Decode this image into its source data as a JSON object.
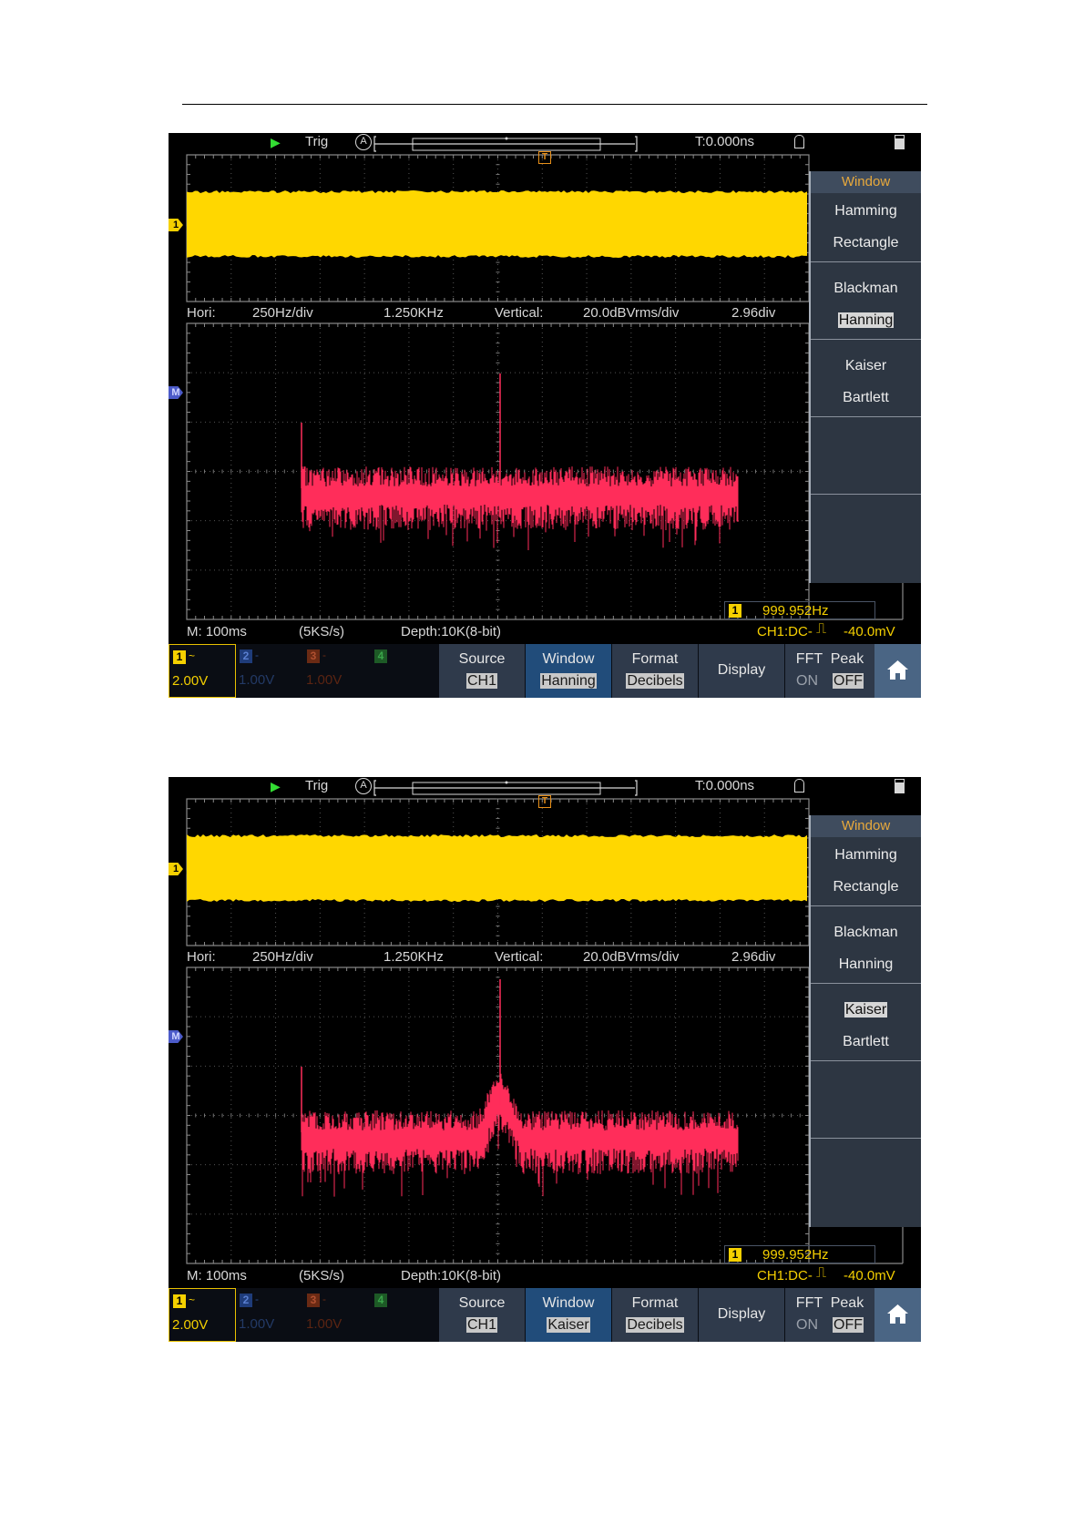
{
  "screens": [
    {
      "top": {
        "trig": "Trig",
        "auto": "A",
        "time": "T:0.000ns"
      },
      "fft_info": {
        "hori_label": "Hori:",
        "hori_scale": "250Hz/div",
        "hori_center": "1.250KHz",
        "vert_label": "Vertical:",
        "vert_scale": "20.0dBVrms/div",
        "vert_pos": "2.96div"
      },
      "markers": {
        "ch1": "1",
        "math": "M",
        "trigger": "T"
      },
      "window_menu": {
        "title": "Window",
        "options": [
          "Hamming",
          "Rectangle",
          "Blackman",
          "Hanning",
          "Kaiser",
          "Bartlett"
        ],
        "selected": "Hanning"
      },
      "freq_counter": {
        "channel": "1",
        "value": "999.952Hz"
      },
      "status": {
        "timebase": "M: 100ms",
        "sample_rate": "(5KS/s)",
        "depth": "Depth:10K(8-bit)",
        "trigger": "CH1:DC-",
        "trigger_level": "-40.0mV"
      },
      "channels": [
        {
          "num": "1",
          "coupling": "~",
          "scale": "2.00V",
          "color": "#f5d000"
        },
        {
          "num": "2",
          "coupling": "-",
          "scale": "1.00V",
          "color": "#3a6fd8"
        },
        {
          "num": "3",
          "coupling": "-",
          "scale": "1.00V",
          "color": "#c0532a"
        },
        {
          "num": "4",
          "coupling": "",
          "scale": "",
          "color": "#2e9a3c"
        }
      ],
      "buttons": {
        "source": {
          "label": "Source",
          "value": "CH1"
        },
        "window": {
          "label": "Window",
          "value": "Hanning"
        },
        "format": {
          "label": "Format",
          "value": "Decibels"
        },
        "display": {
          "label": "Display"
        },
        "fft_peak": {
          "label": "FFT  Peak",
          "on": "ON",
          "off": "OFF"
        }
      },
      "home_icon": "home-icon",
      "waveform_color": "#ffd700",
      "spectrum_color": "#ff2d5a",
      "spectrum_shape": "hanning"
    },
    {
      "top": {
        "trig": "Trig",
        "auto": "A",
        "time": "T:0.000ns"
      },
      "fft_info": {
        "hori_label": "Hori:",
        "hori_scale": "250Hz/div",
        "hori_center": "1.250KHz",
        "vert_label": "Vertical:",
        "vert_scale": "20.0dBVrms/div",
        "vert_pos": "2.96div"
      },
      "markers": {
        "ch1": "1",
        "math": "M",
        "trigger": "T"
      },
      "window_menu": {
        "title": "Window",
        "options": [
          "Hamming",
          "Rectangle",
          "Blackman",
          "Hanning",
          "Kaiser",
          "Bartlett"
        ],
        "selected": "Kaiser"
      },
      "freq_counter": {
        "channel": "1",
        "value": "999.952Hz"
      },
      "status": {
        "timebase": "M: 100ms",
        "sample_rate": "(5KS/s)",
        "depth": "Depth:10K(8-bit)",
        "trigger": "CH1:DC-",
        "trigger_level": "-40.0mV"
      },
      "channels": [
        {
          "num": "1",
          "coupling": "~",
          "scale": "2.00V",
          "color": "#f5d000"
        },
        {
          "num": "2",
          "coupling": "-",
          "scale": "1.00V",
          "color": "#3a6fd8"
        },
        {
          "num": "3",
          "coupling": "-",
          "scale": "1.00V",
          "color": "#c0532a"
        },
        {
          "num": "4",
          "coupling": "",
          "scale": "",
          "color": "#2e9a3c"
        }
      ],
      "buttons": {
        "source": {
          "label": "Source",
          "value": "CH1"
        },
        "window": {
          "label": "Window",
          "value": "Kaiser"
        },
        "format": {
          "label": "Format",
          "value": "Decibels"
        },
        "display": {
          "label": "Display"
        },
        "fft_peak": {
          "label": "FFT  Peak",
          "on": "ON",
          "off": "OFF"
        }
      },
      "home_icon": "home-icon",
      "waveform_color": "#ffd700",
      "spectrum_color": "#ff2d5a",
      "spectrum_shape": "kaiser"
    }
  ]
}
